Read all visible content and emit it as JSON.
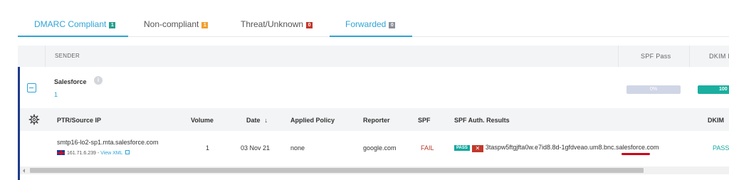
{
  "tabs": [
    {
      "label": "DMARC Compliant",
      "count": "1",
      "badge_color": "#2a9d8f"
    },
    {
      "label": "Non-compliant",
      "count": "1",
      "badge_color": "#f0a030"
    },
    {
      "label": "Threat/Unknown",
      "count": "0",
      "badge_color": "#c0392b"
    },
    {
      "label": "Forwarded",
      "count": "0",
      "badge_color": "#8a8f96"
    }
  ],
  "outer_header": {
    "sender": "SENDER",
    "spf_pass": "SPF Pass",
    "dkim_pass": "DKIM P"
  },
  "sender": {
    "name": "Salesforce",
    "count": "1",
    "info_icon": "info-icon",
    "spf_rate": "0%",
    "dkim_rate": "100"
  },
  "columns": {
    "ptr": "PTR/Source IP",
    "volume": "Volume",
    "date": "Date",
    "date_sort_icon": "↓",
    "policy": "Applied Policy",
    "reporter": "Reporter",
    "spf": "SPF",
    "spf_auth": "SPF Auth. Results",
    "dkim": "DKIM"
  },
  "row": {
    "host": "smtp16-lo2-sp1.mta.salesforce.com",
    "ip": "161.71.6.239",
    "separator": " - ",
    "view_xml": "View XML",
    "volume": "1",
    "date": "03 Nov 21",
    "policy": "none",
    "reporter": "google.com",
    "spf": "FAIL",
    "spf_auth_badge": "PASS",
    "spf_auth_domain": "3taspw5ftgjfta0w.e7id8.8d-1gfdveao.um8.bnc.salesforce.com",
    "dkim": "PASS"
  },
  "colors": {
    "accent": "#2fa4d6",
    "pass": "#13a89e",
    "fail": "#b43a2a",
    "group_border": "#1e3a8a"
  }
}
